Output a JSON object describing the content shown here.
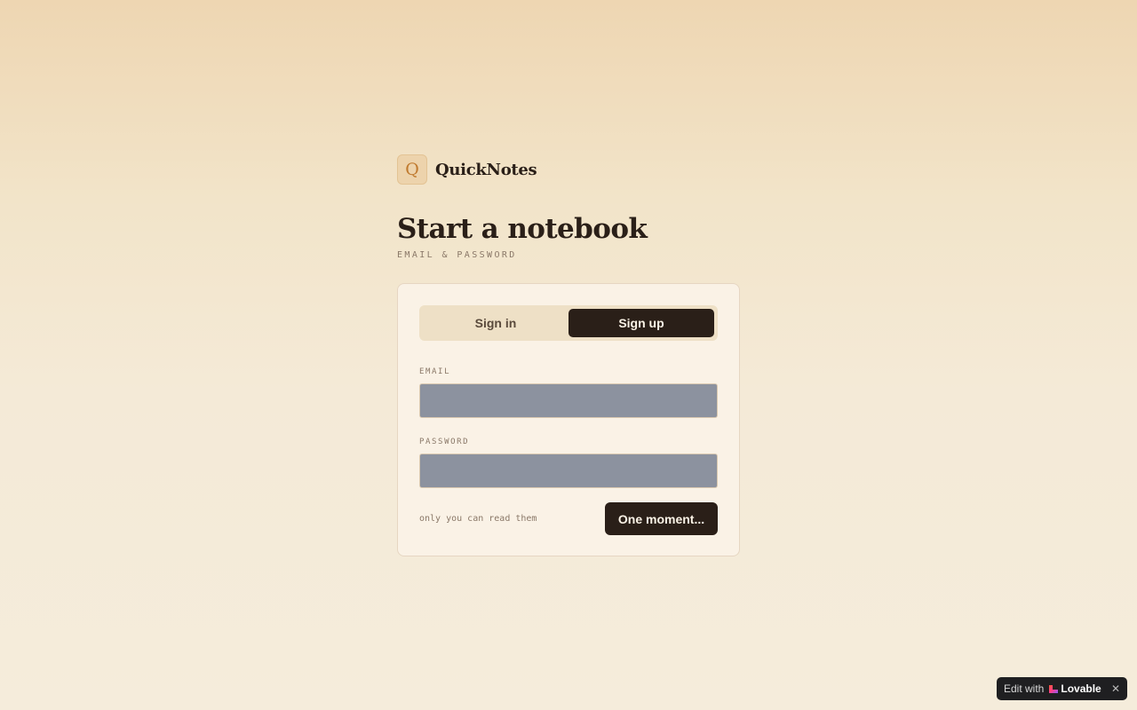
{
  "brand": {
    "logo_letter": "Q",
    "name": "QuickNotes"
  },
  "heading": {
    "title": "Start a notebook",
    "subtitle": "EMAIL & PASSWORD"
  },
  "tabs": [
    {
      "label": "Sign in",
      "active": false
    },
    {
      "label": "Sign up",
      "active": true
    }
  ],
  "form": {
    "email_label": "EMAIL",
    "email_value": "",
    "password_label": "PASSWORD",
    "password_value": "",
    "hint": "only you can read them",
    "submit_label": "One moment..."
  },
  "badge": {
    "prefix": "Edit with",
    "brand": "Lovable",
    "close": "✕"
  },
  "colors": {
    "accent": "#2a1f18",
    "logo_bg": "#edd3ac",
    "logo_text": "#c07a2e",
    "card_bg": "#faf2e6"
  },
  "icons": {
    "logo": "q-logo-icon",
    "badge": "lovable-heart-icon",
    "close": "close-icon"
  }
}
